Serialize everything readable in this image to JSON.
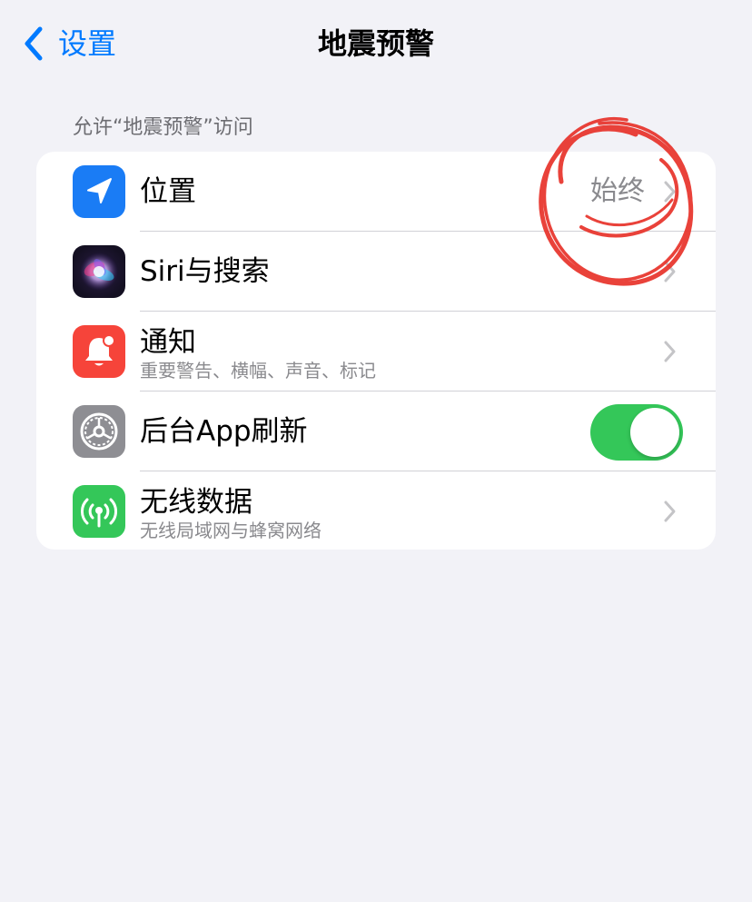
{
  "nav": {
    "back_label": "设置",
    "title": "地震预警"
  },
  "section": {
    "header": "允许“地震预警”访问"
  },
  "rows": [
    {
      "icon": "location-arrow-icon",
      "title": "位置",
      "value": "始终"
    },
    {
      "icon": "siri-icon",
      "title": "Siri与搜索"
    },
    {
      "icon": "notification-bell-icon",
      "title": "通知",
      "subtitle": "重要警告、横幅、声音、标记"
    },
    {
      "icon": "gear-icon",
      "title": "后台App刷新",
      "toggle_on": true
    },
    {
      "icon": "antenna-icon",
      "title": "无线数据",
      "subtitle": "无线局域网与蜂窝网络"
    }
  ],
  "colors": {
    "accent": "#007aff",
    "toggle_on": "#34c759",
    "annotation": "#e8322a",
    "background": "#f2f2f7"
  }
}
